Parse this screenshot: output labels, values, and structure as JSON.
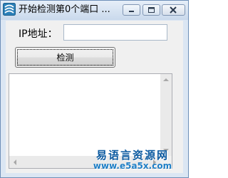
{
  "window": {
    "title": "开始检测第0个端口",
    "title_suffix": "..."
  },
  "form": {
    "ip_label": "IP地址：",
    "ip_value": "",
    "detect_button_label": "检测"
  },
  "output": {
    "text": ""
  },
  "watermark": {
    "line1": "易语言资源网",
    "line2": "www.e5a5x.com"
  },
  "colors": {
    "title_bar": "#c9d9ec",
    "client_bg": "#f0f0f0",
    "watermark_blue": "#0c5aa0"
  }
}
